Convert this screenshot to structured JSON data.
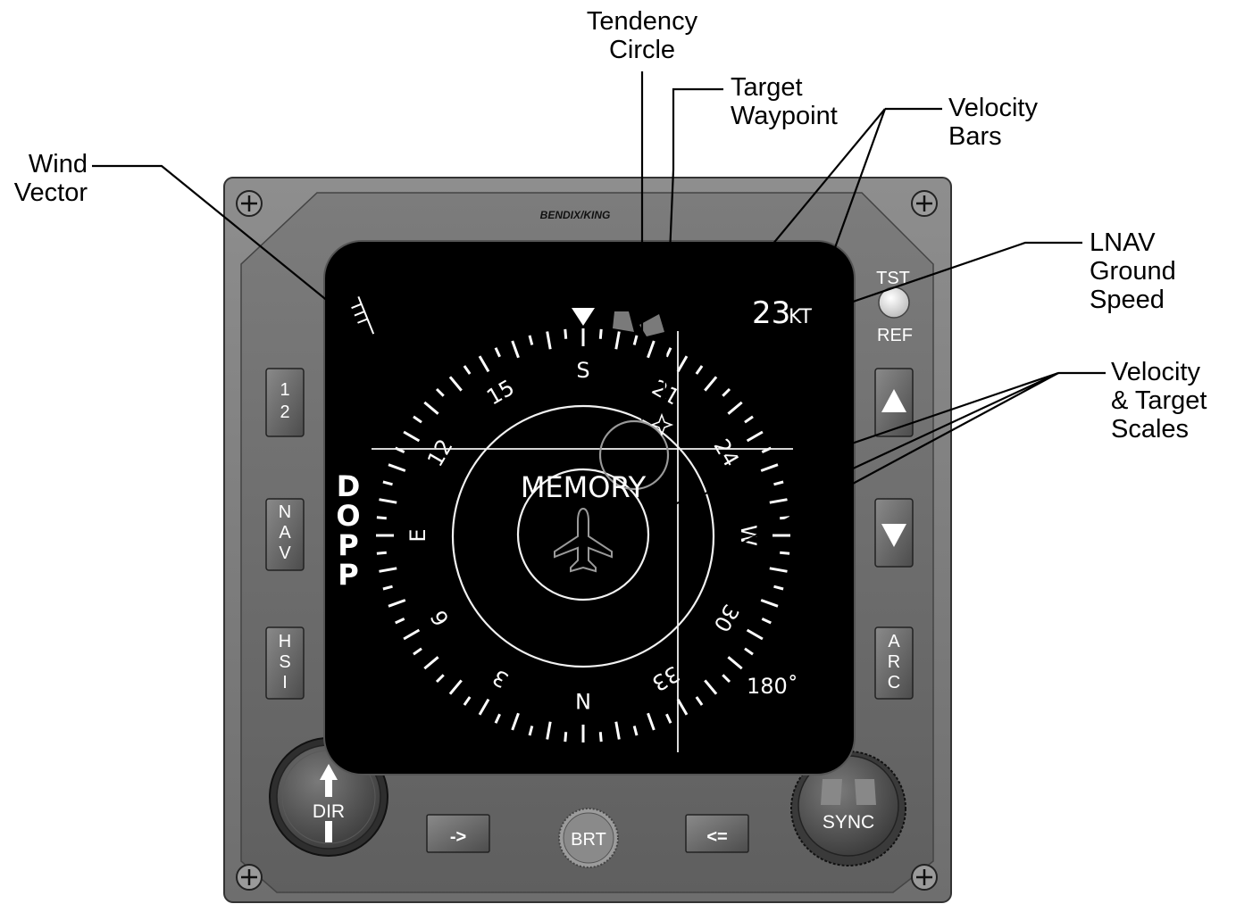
{
  "callouts": {
    "wind_vector": [
      "Wind",
      "Vector"
    ],
    "tendency_circle": [
      "Tendency",
      "Circle"
    ],
    "target_waypoint": [
      "Target",
      "Waypoint"
    ],
    "velocity_bars": [
      "Velocity",
      "Bars"
    ],
    "lnav_ground_speed": [
      "LNAV",
      "Ground",
      "Speed"
    ],
    "velocity_target_scales": [
      "Velocity",
      "& Target",
      "Scales"
    ]
  },
  "bezel": {
    "brand": "BENDIX/KING",
    "left_buttons": [
      {
        "name": "12-button",
        "lines": [
          "1",
          "2"
        ]
      },
      {
        "name": "nav-button",
        "lines": [
          "N",
          "A",
          "V"
        ]
      },
      {
        "name": "hsi-button",
        "lines": [
          "H",
          "S",
          "I"
        ]
      }
    ],
    "right_buttons": [
      {
        "name": "up-button",
        "icon": "triangle-up-icon"
      },
      {
        "name": "down-button",
        "icon": "triangle-down-icon"
      },
      {
        "name": "arc-button",
        "lines": [
          "A",
          "R",
          "C"
        ]
      }
    ],
    "tst_label": "TST",
    "ref_label": "REF",
    "dir_knob": "DIR",
    "sync_knob": "SYNC",
    "brt_knob": "BRT",
    "arrow_right_button": "->",
    "arrow_left_button": "<="
  },
  "screen": {
    "mode_letters": [
      "D",
      "O",
      "P",
      "P"
    ],
    "memory_text": "MEMORY",
    "ground_speed_value": "23",
    "ground_speed_unit": "KT",
    "range_text": "180˚",
    "compass_labels": [
      {
        "text": "N",
        "heading": 0
      },
      {
        "text": "3",
        "heading": 30
      },
      {
        "text": "6",
        "heading": 60
      },
      {
        "text": "E",
        "heading": 90
      },
      {
        "text": "12",
        "heading": 120
      },
      {
        "text": "15",
        "heading": 150
      },
      {
        "text": "S",
        "heading": 180
      },
      {
        "text": "21",
        "heading": 210
      },
      {
        "text": "24",
        "heading": 240
      },
      {
        "text": "W",
        "heading": 270
      },
      {
        "text": "30",
        "heading": 300
      },
      {
        "text": "33",
        "heading": 330
      }
    ]
  }
}
